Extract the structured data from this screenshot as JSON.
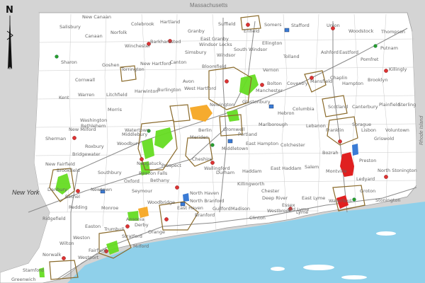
{
  "map": {
    "north_label": "N",
    "state_labels": {
      "massachusetts": "Massachusetts",
      "new_york": "New York",
      "rhode_island": "Rhode Island"
    },
    "colors": {
      "land": "#ffffff",
      "outside": "#d4d4d4",
      "water": "#8fd0ea",
      "town_line": "#c9c9c9",
      "highway": "#8a8a8a",
      "region_outline": "#8a6a2a",
      "green_area": "#66dd22",
      "orange_area": "#f5a623",
      "red_area": "#e02020",
      "blue_area": "#3a7bd5"
    },
    "towns": [
      "New Canaan",
      "Salisbury",
      "Colebrook",
      "Hartland",
      "Granby",
      "Suffield",
      "Enfield",
      "Somers",
      "Stafford",
      "Union",
      "Woodstock",
      "Thompson",
      "Canaan",
      "Norfolk",
      "Barkhamsted",
      "East Granby",
      "Windsor Locks",
      "Ellington",
      "Winchester",
      "Simsbury",
      "South Windsor",
      "Tolland",
      "Ashford",
      "Eastford",
      "Pomfret",
      "Sharon",
      "Goshen",
      "Torrington",
      "New Hartford",
      "Canton",
      "Bloomfield",
      "Windsor",
      "Vernon",
      "Putnam",
      "Killingly",
      "Cornwall",
      "Avon",
      "West Hartford",
      "Bolton",
      "Coventry",
      "Mansfield",
      "Chaplin",
      "Hampton",
      "Brooklyn",
      "Kent",
      "Warren",
      "Litchfield",
      "Harwinton",
      "Burlington",
      "Manchester",
      "Glastonbury",
      "Columbia",
      "Scotland",
      "Canterbury",
      "Plainfield",
      "Sterling",
      "Morris",
      "Washington",
      "Bethlehem",
      "Marlborough",
      "Hebron",
      "Lebanon",
      "Franklin",
      "Sprague",
      "Lisbon",
      "New Milford",
      "Watertown",
      "Middlebury",
      "Cromwell",
      "Portland",
      "East Hampton",
      "Colchester",
      "Bozrah",
      "Griswold",
      "Voluntown",
      "Sherman",
      "Roxbury",
      "Woodbury",
      "Prospect",
      "Cheshire",
      "Durham",
      "Haddam",
      "East Haddam",
      "Salem",
      "Montville",
      "Preston",
      "North Stonington",
      "Bridgewater",
      "New Fairfield",
      "Brookfield",
      "Southbury",
      "Naugatuck",
      "Beacon Falls",
      "Bethany",
      "Ledyard",
      "Danbury",
      "Newtown",
      "Oxford",
      "Seymour",
      "Killingworth",
      "Chester",
      "Deep River",
      "East Lyme",
      "Waterford",
      "Bethel",
      "Redding",
      "Monroe",
      "Woodbridge",
      "North Haven",
      "North Branford",
      "Guilford",
      "Madison",
      "Clinton",
      "Old Lyme",
      "Stonington",
      "Ridgefield",
      "Easton",
      "Trumbull",
      "Weston",
      "Wilton",
      "Westport",
      "Greenwich",
      "Stratford",
      "Branford",
      "East Haven",
      "Orange",
      "Wallingford",
      "Meriden",
      "Berlin",
      "Middletown",
      "Newington",
      "Groton",
      "Ansonia",
      "Derby",
      "Milford",
      "Fairfield",
      "Norwalk",
      "Stamford",
      "Westbrook",
      "Lyme",
      "Essex"
    ]
  }
}
